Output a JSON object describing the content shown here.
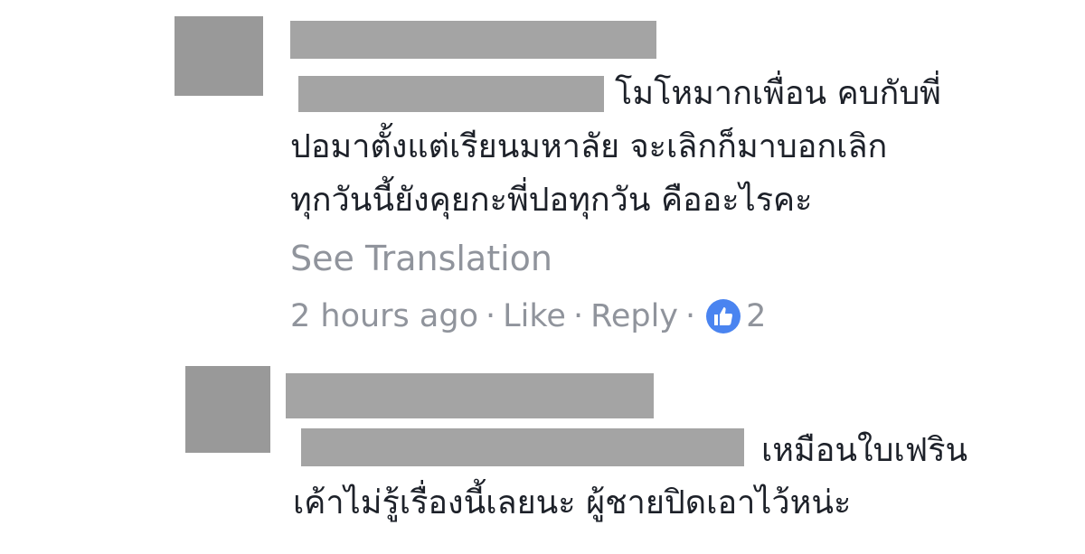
{
  "comment1": {
    "line1_tail": "โมโหมากเพื่อน คบกับพี่",
    "line2": "ปอมาตั้งแต่เรียนมหาลัย จะเลิกก็มาบอกเลิก",
    "line3": "ทุกวันนี้ยังคุยกะพี่ปอทุกวัน คืออะไรคะ",
    "see_translation": "See Translation",
    "time": "2 hours ago",
    "like_label": "Like",
    "reply_label": "Reply",
    "reaction_count": "2",
    "reaction_icon": "thumbs-up-icon",
    "reaction_color": "#4a84f0"
  },
  "comment2": {
    "line1_tail": "เหมือนใบเฟริน",
    "line2": "เค้าไม่รู้เรื่องนี้เลยนะ ผู้ชายปิดเอาไว้หน่ะ"
  },
  "colors": {
    "text": "#1d2129",
    "meta": "#90949c",
    "redaction": "#a4a4a4",
    "avatar_placeholder": "#999999"
  }
}
